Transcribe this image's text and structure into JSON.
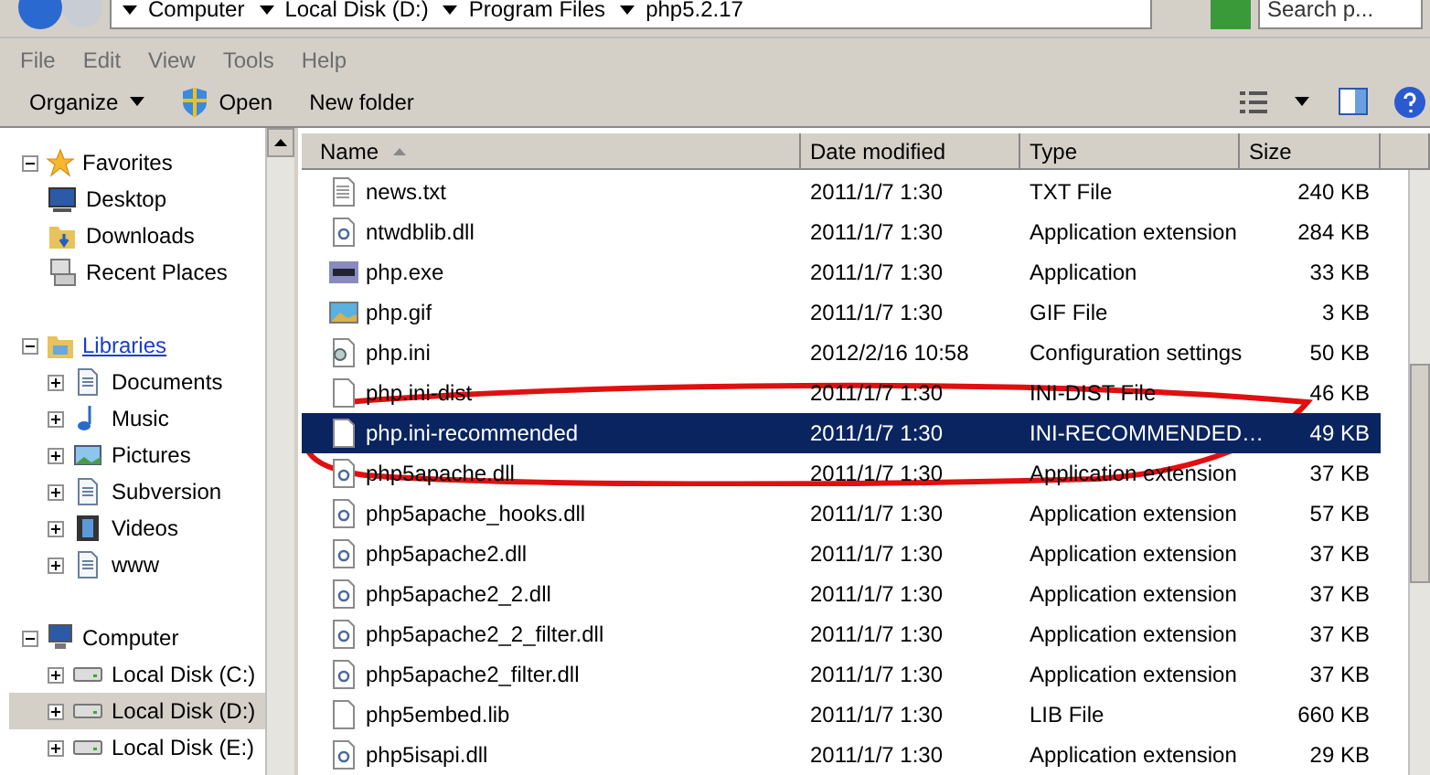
{
  "address_bar": {
    "crumbs": [
      "Computer",
      "Local Disk (D:)",
      "Program Files",
      "php5.2.17"
    ],
    "search": {
      "placeholder": "Search p..."
    }
  },
  "menu": [
    "File",
    "Edit",
    "View",
    "Tools",
    "Help"
  ],
  "toolbar": [
    {
      "label": "Organize",
      "kind": "dropdown"
    },
    {
      "label": "Open",
      "kind": "open"
    },
    {
      "label": "New folder",
      "kind": "plain"
    }
  ],
  "navigation": [
    {
      "label": "Favorites",
      "expanded": true,
      "link": false,
      "children": [
        {
          "label": "Desktop",
          "selected": false
        },
        {
          "label": "Downloads",
          "selected": false
        },
        {
          "label": "Recent Places",
          "selected": false
        }
      ]
    },
    {
      "label": "Libraries",
      "expanded": true,
      "link": true,
      "children": [
        {
          "label": "Documents",
          "expanded": false,
          "selected": false
        },
        {
          "label": "Music",
          "expanded": false,
          "selected": false
        },
        {
          "label": "Pictures",
          "expanded": false,
          "selected": false
        },
        {
          "label": "Subversion",
          "expanded": false,
          "selected": false
        },
        {
          "label": "Videos",
          "expanded": false,
          "selected": false
        },
        {
          "label": "www",
          "expanded": false,
          "selected": false
        }
      ]
    },
    {
      "label": "Computer",
      "expanded": true,
      "link": false,
      "children": [
        {
          "label": "Local Disk (C:)",
          "expanded": false,
          "selected": false
        },
        {
          "label": "Local Disk (D:)",
          "expanded": false,
          "selected": true
        },
        {
          "label": "Local Disk (E:)",
          "expanded": false,
          "selected": false
        }
      ]
    }
  ],
  "table": {
    "columns": [
      "Name",
      "Date modified",
      "Type",
      "Size"
    ],
    "rows": [
      {
        "name": "news.txt",
        "kind": "text",
        "date": "2011/1/7 1:30",
        "type": "TXT File",
        "size": "240 KB",
        "selected": false
      },
      {
        "name": "ntwdblib.dll",
        "kind": "dll",
        "date": "2011/1/7 1:30",
        "type": "Application extension",
        "size": "284 KB",
        "selected": false
      },
      {
        "name": "php.exe",
        "kind": "exe",
        "date": "2011/1/7 1:30",
        "type": "Application",
        "size": "33 KB",
        "selected": false
      },
      {
        "name": "php.gif",
        "kind": "image",
        "date": "2011/1/7 1:30",
        "type": "GIF File",
        "size": "3 KB",
        "selected": false
      },
      {
        "name": "php.ini",
        "kind": "settings",
        "date": "2012/2/16 10:58",
        "type": "Configuration settings",
        "size": "50 KB",
        "selected": false
      },
      {
        "name": "php.ini-dist",
        "kind": "blank",
        "date": "2011/1/7 1:30",
        "type": "INI-DIST File",
        "size": "46 KB",
        "selected": false
      },
      {
        "name": "php.ini-recommended",
        "kind": "blank",
        "date": "2011/1/7 1:30",
        "type": "INI-RECOMMENDED…",
        "size": "49 KB",
        "selected": true
      },
      {
        "name": "php5apache.dll",
        "kind": "dll",
        "date": "2011/1/7 1:30",
        "type": "Application extension",
        "size": "37 KB",
        "selected": false
      },
      {
        "name": "php5apache_hooks.dll",
        "kind": "dll",
        "date": "2011/1/7 1:30",
        "type": "Application extension",
        "size": "57 KB",
        "selected": false
      },
      {
        "name": "php5apache2.dll",
        "kind": "dll",
        "date": "2011/1/7 1:30",
        "type": "Application extension",
        "size": "37 KB",
        "selected": false
      },
      {
        "name": "php5apache2_2.dll",
        "kind": "dll",
        "date": "2011/1/7 1:30",
        "type": "Application extension",
        "size": "37 KB",
        "selected": false
      },
      {
        "name": "php5apache2_2_filter.dll",
        "kind": "dll",
        "date": "2011/1/7 1:30",
        "type": "Application extension",
        "size": "37 KB",
        "selected": false
      },
      {
        "name": "php5apache2_filter.dll",
        "kind": "dll",
        "date": "2011/1/7 1:30",
        "type": "Application extension",
        "size": "37 KB",
        "selected": false
      },
      {
        "name": "php5embed.lib",
        "kind": "blank",
        "date": "2011/1/7 1:30",
        "type": "LIB File",
        "size": "660 KB",
        "selected": false
      },
      {
        "name": "php5isapi.dll",
        "kind": "dll",
        "date": "2011/1/7 1:30",
        "type": "Application extension",
        "size": "29 KB",
        "selected": false
      }
    ]
  }
}
